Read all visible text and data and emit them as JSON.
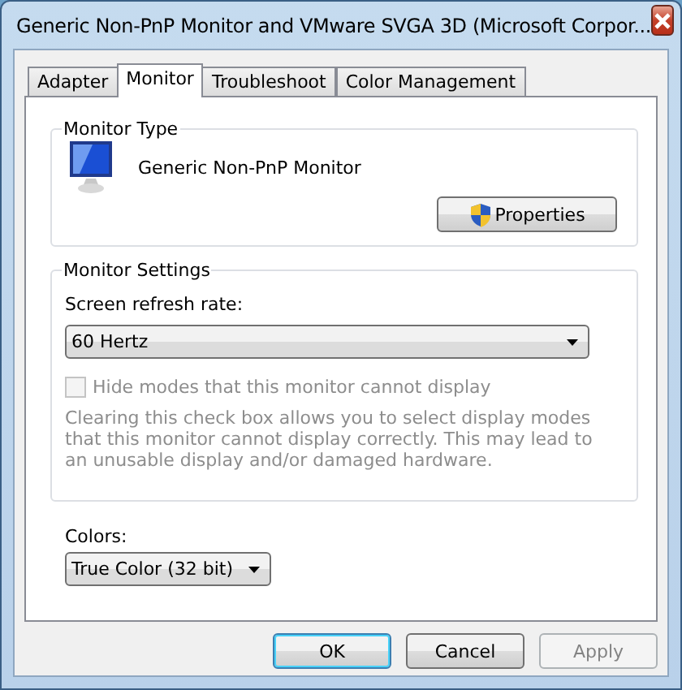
{
  "window": {
    "title": "Generic Non-PnP Monitor and VMware SVGA 3D (Microsoft Corpor..."
  },
  "tabs": [
    {
      "label": "Adapter",
      "selected": false
    },
    {
      "label": "Monitor",
      "selected": true
    },
    {
      "label": "Troubleshoot",
      "selected": false
    },
    {
      "label": "Color Management",
      "selected": false
    }
  ],
  "monitor_type": {
    "legend": "Monitor Type",
    "monitor_name": "Generic Non-PnP Monitor",
    "properties_button": "Properties"
  },
  "monitor_settings": {
    "legend": "Monitor Settings",
    "refresh_label": "Screen refresh rate:",
    "refresh_dropdown": {
      "value": "60 Hertz"
    },
    "hide_modes": {
      "label": "Hide modes that this monitor cannot display",
      "checked": false,
      "disabled": true
    },
    "description": "Clearing this check box allows you to select display modes that this monitor cannot display correctly. This may lead to an unusable display and/or damaged hardware."
  },
  "colors": {
    "label": "Colors:",
    "dropdown": {
      "value": "True Color (32 bit)"
    }
  },
  "buttons": [
    {
      "label": "OK",
      "kind": "default",
      "disabled": false
    },
    {
      "label": "Cancel",
      "kind": "normal",
      "disabled": false
    },
    {
      "label": "Apply",
      "kind": "normal",
      "disabled": true
    }
  ]
}
